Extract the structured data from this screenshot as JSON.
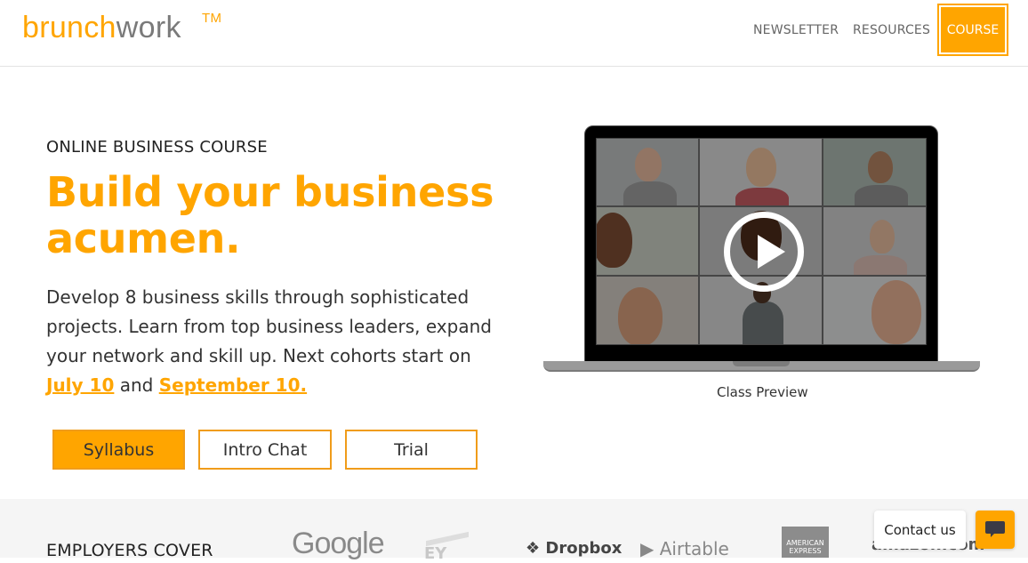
{
  "brand": {
    "logo_part1": "brunch",
    "logo_part2": "work",
    "trademark": "TM",
    "accent_color": "#ffa500"
  },
  "nav": {
    "items": [
      {
        "label": "NEWSLETTER"
      },
      {
        "label": "RESOURCES"
      },
      {
        "label": "COURSE",
        "active": true
      }
    ]
  },
  "hero": {
    "eyebrow": "ONLINE BUSINESS COURSE",
    "headline": "Build your business acumen.",
    "description_prefix": "Develop 8 business skills through sophisticated projects. Learn from top business leaders, expand your network and skill up. Next cohorts start on ",
    "link1": "July 10",
    "between": " and ",
    "link2": "September 10.",
    "buttons": {
      "syllabus": "Syllabus",
      "intro_chat": "Intro Chat",
      "trial": "Trial"
    }
  },
  "video": {
    "caption": "Class Preview",
    "play_icon": "play-icon",
    "participants": 9
  },
  "employers": {
    "label": "EMPLOYERS COVER",
    "logos": [
      "Google",
      "EY",
      "Dropbox",
      "Airtable",
      "AMERICAN EXPRESS",
      "amazon.com"
    ]
  },
  "contact": {
    "label": "Contact us",
    "icon": "chat-icon"
  }
}
